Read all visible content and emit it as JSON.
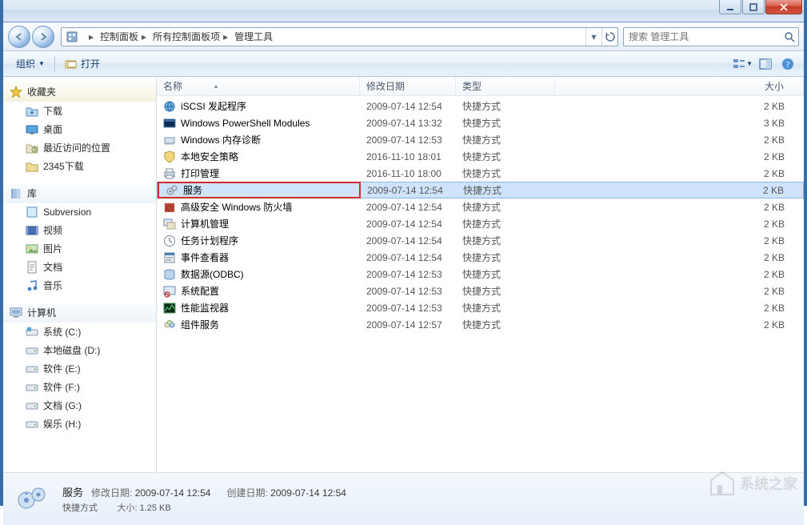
{
  "window": {
    "breadcrumb": [
      "控制面板",
      "所有控制面板项",
      "管理工具"
    ],
    "search_placeholder": "搜索 管理工具"
  },
  "cmdbar": {
    "organize": "组织",
    "open": "打开"
  },
  "sidebar": {
    "favorites": {
      "label": "收藏夹",
      "items": [
        "下载",
        "桌面",
        "最近访问的位置",
        "2345下载"
      ]
    },
    "libraries": {
      "label": "库",
      "items": [
        "Subversion",
        "视频",
        "图片",
        "文档",
        "音乐"
      ]
    },
    "computer": {
      "label": "计算机",
      "items": [
        "系统 (C:)",
        "本地磁盘 (D:)",
        "软件 (E:)",
        "软件 (F:)",
        "文档 (G:)",
        "娱乐 (H:)"
      ]
    }
  },
  "columns": {
    "name": "名称",
    "date": "修改日期",
    "type": "类型",
    "size": "大小"
  },
  "rows": [
    {
      "icon": "globe",
      "name": "iSCSI 发起程序",
      "date": "2009-07-14 12:54",
      "type": "快捷方式",
      "size": "2 KB",
      "sel": false
    },
    {
      "icon": "shell",
      "name": "Windows PowerShell Modules",
      "date": "2009-07-14 13:32",
      "type": "快捷方式",
      "size": "3 KB",
      "sel": false
    },
    {
      "icon": "mem",
      "name": "Windows 内存诊断",
      "date": "2009-07-14 12:53",
      "type": "快捷方式",
      "size": "2 KB",
      "sel": false
    },
    {
      "icon": "shield",
      "name": "本地安全策略",
      "date": "2016-11-10 18:01",
      "type": "快捷方式",
      "size": "2 KB",
      "sel": false
    },
    {
      "icon": "printer",
      "name": "打印管理",
      "date": "2016-11-10 18:00",
      "type": "快捷方式",
      "size": "2 KB",
      "sel": false
    },
    {
      "icon": "gears",
      "name": "服务",
      "date": "2009-07-14 12:54",
      "type": "快捷方式",
      "size": "2 KB",
      "sel": true,
      "highlight": true
    },
    {
      "icon": "firewall",
      "name": "高级安全 Windows 防火墙",
      "date": "2009-07-14 12:54",
      "type": "快捷方式",
      "size": "2 KB",
      "sel": false
    },
    {
      "icon": "mgmt",
      "name": "计算机管理",
      "date": "2009-07-14 12:54",
      "type": "快捷方式",
      "size": "2 KB",
      "sel": false
    },
    {
      "icon": "clock",
      "name": "任务计划程序",
      "date": "2009-07-14 12:54",
      "type": "快捷方式",
      "size": "2 KB",
      "sel": false
    },
    {
      "icon": "event",
      "name": "事件查看器",
      "date": "2009-07-14 12:54",
      "type": "快捷方式",
      "size": "2 KB",
      "sel": false
    },
    {
      "icon": "odbc",
      "name": "数据源(ODBC)",
      "date": "2009-07-14 12:53",
      "type": "快捷方式",
      "size": "2 KB",
      "sel": false
    },
    {
      "icon": "sysconf",
      "name": "系统配置",
      "date": "2009-07-14 12:53",
      "type": "快捷方式",
      "size": "2 KB",
      "sel": false
    },
    {
      "icon": "perf",
      "name": "性能监视器",
      "date": "2009-07-14 12:53",
      "type": "快捷方式",
      "size": "2 KB",
      "sel": false
    },
    {
      "icon": "comp",
      "name": "组件服务",
      "date": "2009-07-14 12:57",
      "type": "快捷方式",
      "size": "2 KB",
      "sel": false
    }
  ],
  "details": {
    "name": "服务",
    "type": "快捷方式",
    "mod_label": "修改日期:",
    "mod_value": "2009-07-14 12:54",
    "size_label": "大小:",
    "size_value": "1.25 KB",
    "create_label": "创建日期:",
    "create_value": "2009-07-14 12:54"
  },
  "watermark": "系统之家"
}
